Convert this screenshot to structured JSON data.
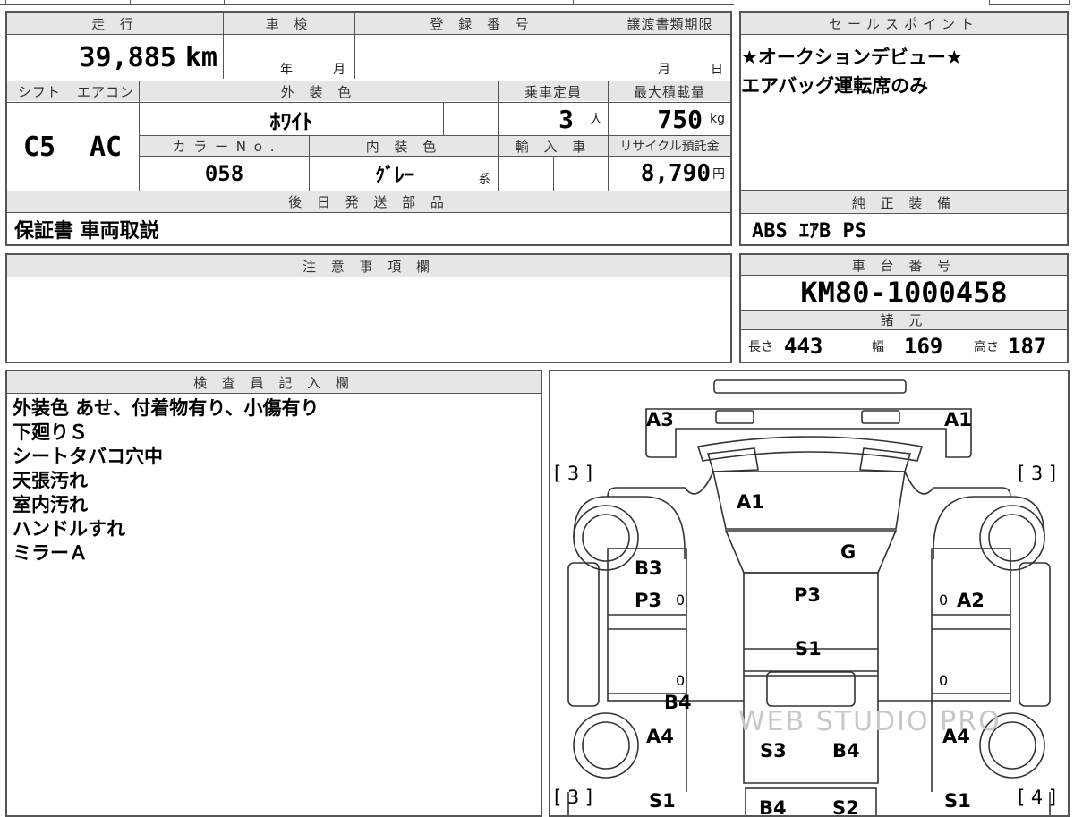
{
  "top_row": {
    "headers": {
      "mileage": "走 行",
      "inspection": "車 検",
      "registration": "登 録 番 号",
      "transfer_deadline": "譲渡書類期限",
      "sales_point": "セールスポイント"
    },
    "mileage_value": "39,885",
    "mileage_unit": "km",
    "inspection_year_label": "年",
    "inspection_month_label": "月",
    "transfer_month_label": "月",
    "transfer_day_label": "日"
  },
  "sales_points": {
    "lines": [
      "★オークションデビュー★",
      "エアバッグ運転席のみ"
    ]
  },
  "row2": {
    "headers": {
      "shift": "シフト",
      "aircon": "エアコン",
      "exterior_color": "外 装 色",
      "capacity": "乗車定員",
      "max_load": "最大積載量",
      "color_no": "カ ラ ー N o .",
      "interior_color": "内 装 色",
      "import": "輸 入 車",
      "recycle": "リサイクル預託金"
    },
    "shift_value": "C5",
    "aircon_value": "AC",
    "exterior_color_value": "ﾎﾜｲﾄ",
    "capacity_value": "3",
    "capacity_unit": "人",
    "max_load_value": "750",
    "max_load_unit": "kg",
    "color_no_value": "058",
    "interior_color_value": "ｸﾞﾚｰ",
    "interior_suffix": "系",
    "recycle_value": "8,790",
    "recycle_unit": "円"
  },
  "later_parts": {
    "header": "後 日 発 送 部 品",
    "value": "保証書 車両取説"
  },
  "standard_equipment": {
    "header": "純 正 装 備",
    "value": "ABS ｴｱB PS"
  },
  "caution": {
    "header": "注 意 事 項 欄"
  },
  "chassis": {
    "header": "車 台 番 号",
    "value": "KM80-1000458",
    "specs_header": "諸 元",
    "length_label": "長さ",
    "length_value": "443",
    "width_label": "幅",
    "width_value": "169",
    "height_label": "高さ",
    "height_value": "187"
  },
  "inspector": {
    "header": "検 査 員 記 入 欄",
    "notes": [
      "外装色 あせ、付着物有り、小傷有り",
      "下廻りＳ",
      "シートタバコ穴中",
      "天張汚れ",
      "室内汚れ",
      "ハンドルすれ",
      "ミラーＡ"
    ]
  },
  "diagram": {
    "labels": {
      "a3_top": "A3",
      "a1_top": "A1",
      "bracket_left_upper": "[ 3 ]",
      "bracket_right_upper": "[ 3 ]",
      "a1_hood": "A1",
      "g_windshield": "G",
      "b3_left": "B3",
      "p3_left": "P3",
      "zero_left_upper": "0",
      "p3_roof": "P3",
      "zero_right_upper": "0",
      "a2_right": "A2",
      "s1_roof": "S1",
      "zero_left_lower": "0",
      "zero_right_lower": "0",
      "b4_left": "B4",
      "a4_left": "A4",
      "a4_right": "A4",
      "s3_bed": "S3",
      "b4_bed": "B4",
      "bracket_left_lower": "[ 3 ]",
      "s1_left_lower": "S1",
      "b4_bottom": "B4",
      "s2_bottom": "S2",
      "s1_right_lower": "S1",
      "bracket_right_lower": "[ 4 ]"
    },
    "watermark": "WEB STUDIO PRO"
  }
}
